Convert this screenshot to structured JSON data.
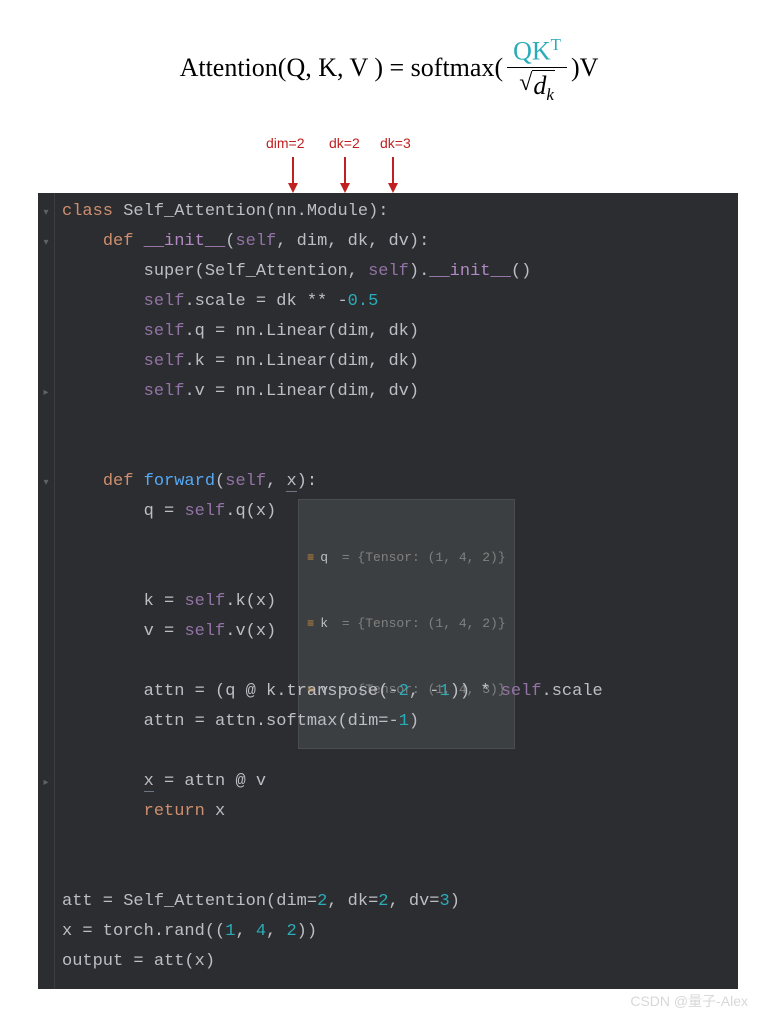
{
  "formula": {
    "lhs_fn": "Attention",
    "lhs_args": "(Q, K, V )",
    "rhs_fn": "softmax",
    "frac_num": "QK",
    "frac_num_sup": "T",
    "frac_den_radicand": "d",
    "frac_den_sub": "k",
    "tail": ")V"
  },
  "annotations": {
    "a1": "dim=2",
    "a2": "dk=2",
    "a3": "dk=3"
  },
  "code": {
    "l1_kw": "class",
    "l1_cls": " Self_Attention",
    "l1_paren": "(nn.Module):",
    "l2_def": "def ",
    "l2_name": "__init__",
    "l2_args1": "(",
    "l2_self": "self",
    "l2_args2": ", dim, dk, dv):",
    "l3_a": "super(Self_Attention, ",
    "l3_self": "self",
    "l3_b": ").",
    "l3_init": "__init__",
    "l3_c": "()",
    "l4_self": "self",
    "l4_a": ".scale = dk ** -",
    "l4_num": "0.5",
    "l5_self": "self",
    "l5_a": ".q = nn.Linear(dim, dk)",
    "l6_self": "self",
    "l6_a": ".k = nn.Linear(dim, dk)",
    "l7_self": "self",
    "l7_a": ".v = nn.Linear(dim, dv)",
    "l8_def": "def ",
    "l8_name": "forward",
    "l8_a": "(",
    "l8_self": "self",
    "l8_b": ", ",
    "l8_x": "x",
    "l8_c": "):",
    "l9_a": "q = ",
    "l9_self": "self",
    "l9_b": ".q(x)",
    "l10_a": "k = ",
    "l10_self": "self",
    "l10_b": ".k(x)",
    "l11_a": "v = ",
    "l11_self": "self",
    "l11_b": ".v(x)",
    "l12_a": "attn = (q @ k.transpose(-",
    "l12_n1": "2",
    "l12_b": ", -",
    "l12_n2": "1",
    "l12_c": ")) * ",
    "l12_self": "self",
    "l12_d": ".scale",
    "l13_a": "attn = attn.softmax(",
    "l13_kw": "dim",
    "l13_b": "=-",
    "l13_n": "1",
    "l13_c": ")",
    "l14_x": "x",
    "l14_a": " = attn @ v",
    "l15_ret": "return ",
    "l15_x": "x",
    "l16_a": "att = Self_Attention(",
    "l16_p1": "dim",
    "l16_e1": "=",
    "l16_n1": "2",
    "l16_s1": ", ",
    "l16_p2": "dk",
    "l16_e2": "=",
    "l16_n2": "2",
    "l16_s2": ", ",
    "l16_p3": "dv",
    "l16_e3": "=",
    "l16_n3": "3",
    "l16_c": ")",
    "l17_a": "x = torch.rand((",
    "l17_n1": "1",
    "l17_s1": ", ",
    "l17_n2": "4",
    "l17_s2": ", ",
    "l17_n3": "2",
    "l17_c": "))",
    "l18_a": "output = att(x)"
  },
  "hints": {
    "q_var": "q",
    "q_val": " = {Tensor: (1, 4, 2)}",
    "k_var": "k",
    "k_val": " = {Tensor: (1, 4, 2)}",
    "v_var": "v",
    "v_val": " = {Tensor: (1, 4, 3)}"
  },
  "watermark": "CSDN @量子-Alex"
}
